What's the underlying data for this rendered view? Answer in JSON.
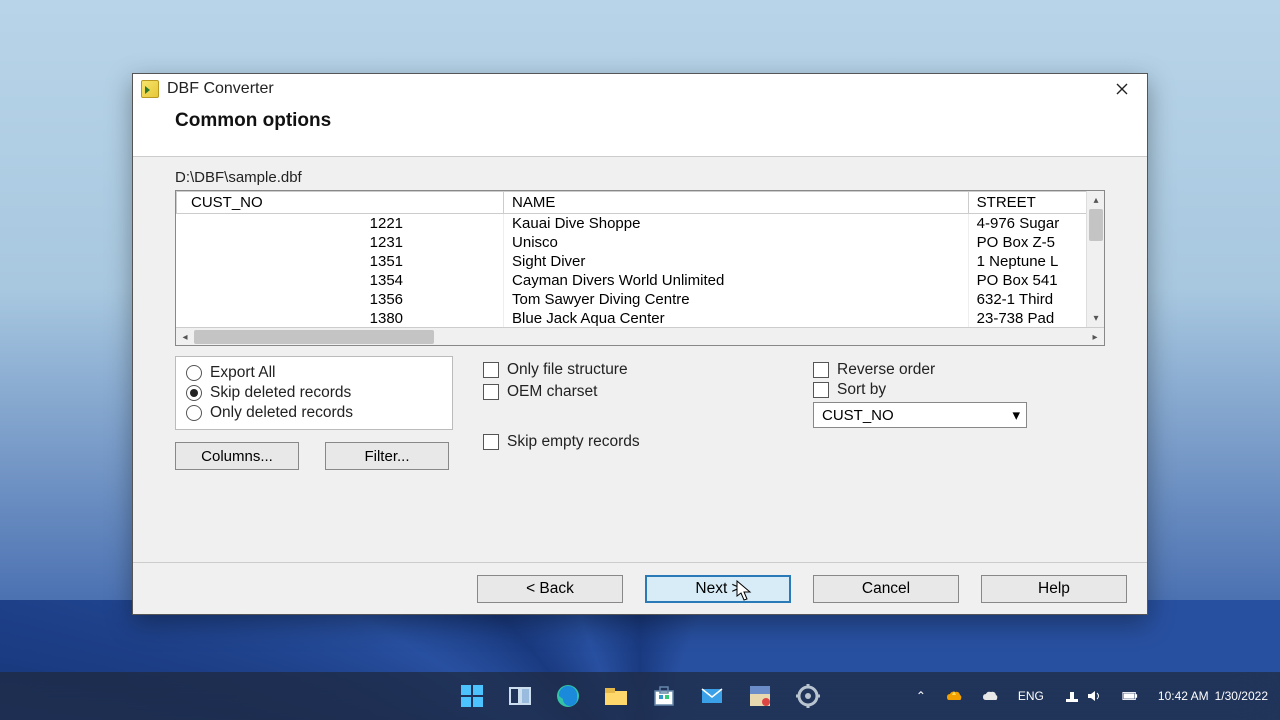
{
  "window": {
    "title": "DBF Converter",
    "section_heading": "Common options",
    "file_path": "D:\\DBF\\sample.dbf"
  },
  "table": {
    "columns": [
      "CUST_NO",
      "NAME",
      "STREET"
    ],
    "rows": [
      {
        "cust_no": "1221",
        "name": "Kauai Dive Shoppe",
        "street": "4-976 Sugar"
      },
      {
        "cust_no": "1231",
        "name": "Unisco",
        "street": "PO Box Z-5"
      },
      {
        "cust_no": "1351",
        "name": "Sight Diver",
        "street": "1 Neptune L"
      },
      {
        "cust_no": "1354",
        "name": "Cayman Divers World Unlimited",
        "street": "PO Box 541"
      },
      {
        "cust_no": "1356",
        "name": "Tom Sawyer Diving Centre",
        "street": "632-1 Third"
      },
      {
        "cust_no": "1380",
        "name": "Blue Jack Aqua Center",
        "street": "23-738 Pad"
      }
    ]
  },
  "radios": {
    "export_all": "Export All",
    "skip_deleted": "Skip deleted records",
    "only_deleted": "Only deleted records",
    "selected": "skip_deleted"
  },
  "checks": {
    "only_structure": "Only file structure",
    "oem_charset": "OEM charset",
    "skip_empty": "Skip empty records",
    "reverse_order": "Reverse order",
    "sort_by": "Sort by"
  },
  "sort_by_value": "CUST_NO",
  "buttons": {
    "columns": "Columns...",
    "filter": "Filter...",
    "back": "< Back",
    "next": "Next >",
    "cancel": "Cancel",
    "help": "Help"
  },
  "taskbar": {
    "lang": "ENG",
    "time": "10:42 AM",
    "date": "1/30/2022"
  }
}
